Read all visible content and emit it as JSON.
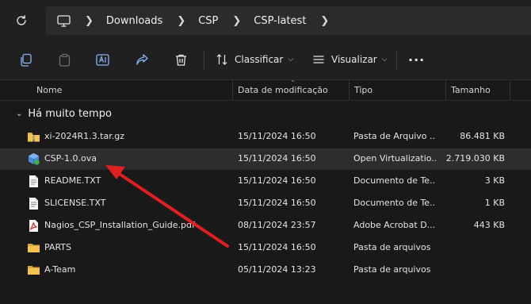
{
  "breadcrumb": {
    "items": [
      {
        "label": "Downloads"
      },
      {
        "label": "CSP"
      },
      {
        "label": "CSP-latest"
      }
    ]
  },
  "toolbar": {
    "icons": [
      "copy-icon",
      "paste-icon",
      "rename-icon",
      "share-icon",
      "delete-icon"
    ],
    "sort_label": "Classificar",
    "view_label": "Visualizar",
    "more_label": "···"
  },
  "columns": {
    "name": "Nome",
    "date": "Data de modificação",
    "type": "Tipo",
    "size": "Tamanho"
  },
  "group": {
    "label": "Há muito tempo"
  },
  "files": [
    {
      "name": "xi-2024R1.3.tar.gz",
      "date": "15/11/2024 16:50",
      "type": "Pasta de Arquivo ...",
      "size": "86.481 KB",
      "icon": "archive-icon"
    },
    {
      "name": "CSP-1.0.ova",
      "date": "15/11/2024 16:50",
      "type": "Open Virtualizatio...",
      "size": "2.719.030 KB",
      "icon": "ova-icon",
      "selected": true
    },
    {
      "name": "README.TXT",
      "date": "15/11/2024 16:50",
      "type": "Documento de Te...",
      "size": "3 KB",
      "icon": "text-file-icon"
    },
    {
      "name": "SLICENSE.TXT",
      "date": "15/11/2024 16:50",
      "type": "Documento de Te...",
      "size": "1 KB",
      "icon": "text-file-icon"
    },
    {
      "name": "Nagios_CSP_Installation_Guide.pdf",
      "date": "08/11/2024 23:57",
      "type": "Adobe Acrobat D...",
      "size": "443 KB",
      "icon": "pdf-icon"
    },
    {
      "name": "PARTS",
      "date": "15/11/2024 16:50",
      "type": "Pasta de arquivos",
      "size": "",
      "icon": "folder-icon"
    },
    {
      "name": "A-Team",
      "date": "05/11/2024 13:23",
      "type": "Pasta de arquivos",
      "size": "",
      "icon": "folder-icon"
    }
  ],
  "colors": {
    "background": "#191919",
    "selected_row": "#2d2d2d",
    "annotation_arrow": "#e02020",
    "folder": "#f2c14e",
    "pdf": "#d42b2b"
  }
}
